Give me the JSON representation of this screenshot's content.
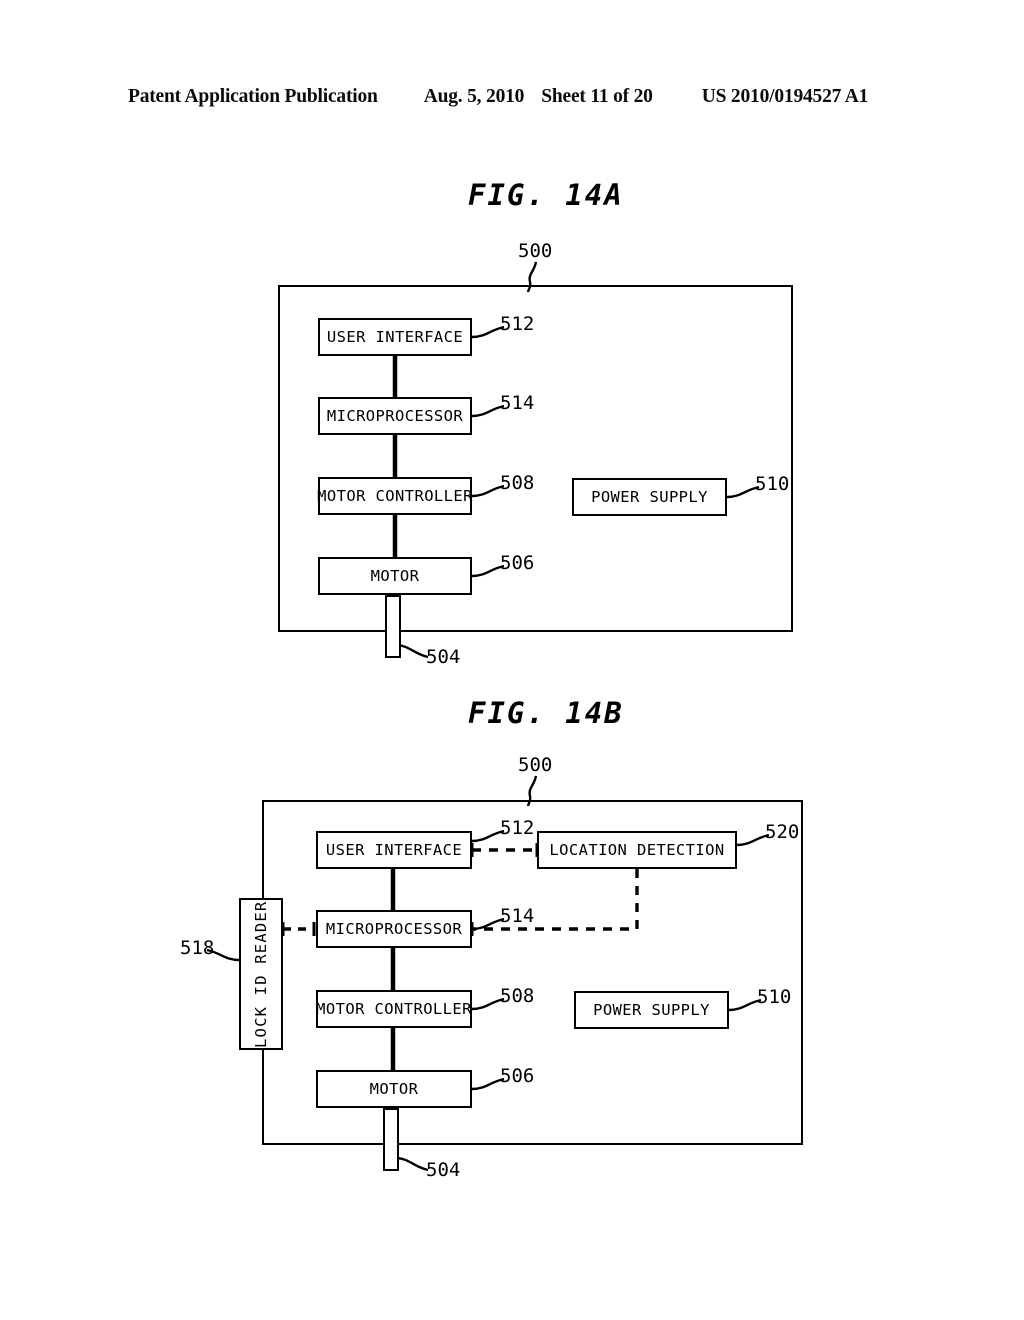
{
  "header": {
    "publication": "Patent Application Publication",
    "date": "Aug. 5, 2010",
    "sheet": "Sheet 11 of 20",
    "doc_number": "US 2010/0194527 A1"
  },
  "figures": [
    {
      "id": "fig-14a",
      "title": "FIG. 14A",
      "enclosure_label": "500",
      "shaft_label": "504",
      "blocks": [
        {
          "name": "user-interface",
          "label": "USER INTERFACE",
          "ref": "512"
        },
        {
          "name": "microprocessor",
          "label": "MICROPROCESSOR",
          "ref": "514"
        },
        {
          "name": "motor-controller",
          "label": "MOTOR CONTROLLER",
          "ref": "508"
        },
        {
          "name": "motor",
          "label": "MOTOR",
          "ref": "506"
        },
        {
          "name": "power-supply",
          "label": "POWER SUPPLY",
          "ref": "510"
        }
      ]
    },
    {
      "id": "fig-14b",
      "title": "FIG. 14B",
      "enclosure_label": "500",
      "shaft_label": "504",
      "blocks": [
        {
          "name": "user-interface",
          "label": "USER INTERFACE",
          "ref": "512"
        },
        {
          "name": "location-detection",
          "label": "LOCATION DETECTION",
          "ref": "520"
        },
        {
          "name": "microprocessor",
          "label": "MICROPROCESSOR",
          "ref": "514"
        },
        {
          "name": "lock-id-reader",
          "label": "LOCK ID READER",
          "ref": "518"
        },
        {
          "name": "motor-controller",
          "label": "MOTOR CONTROLLER",
          "ref": "508"
        },
        {
          "name": "motor",
          "label": "MOTOR",
          "ref": "506"
        },
        {
          "name": "power-supply",
          "label": "POWER SUPPLY",
          "ref": "510"
        }
      ]
    }
  ],
  "colors": {
    "ink": "#000000",
    "paper": "#ffffff"
  }
}
